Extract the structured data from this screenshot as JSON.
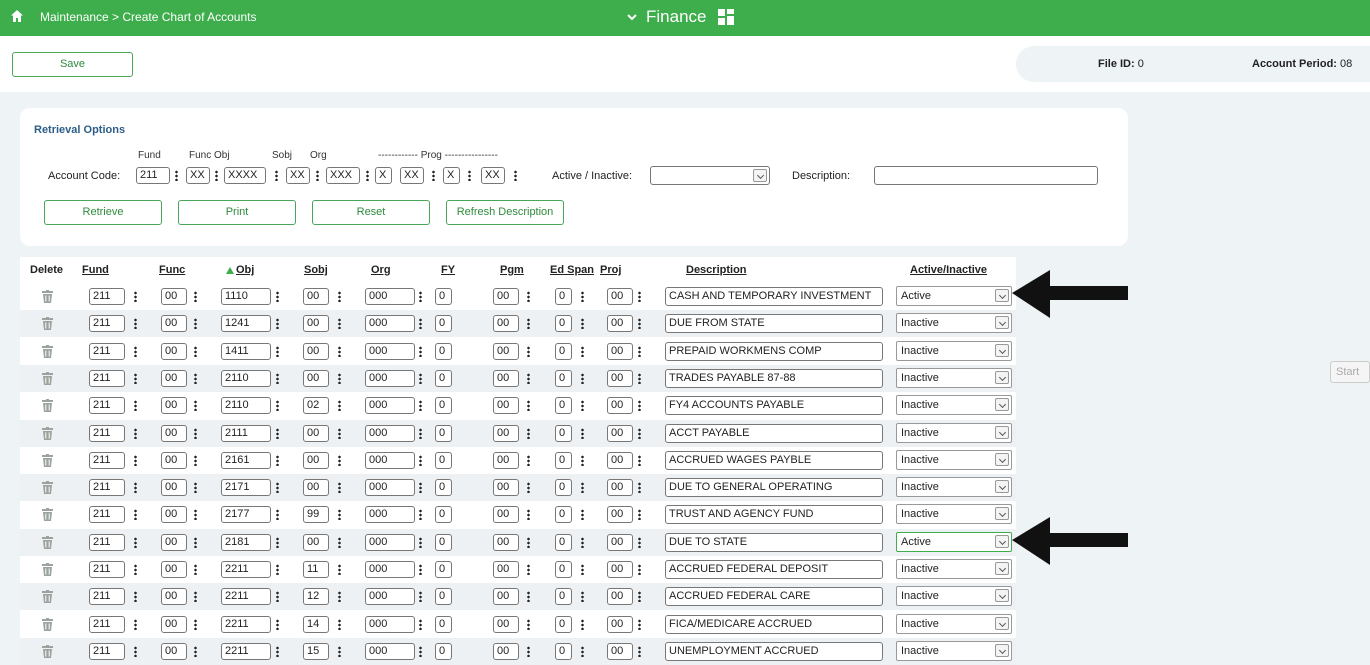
{
  "topbar": {
    "breadcrumb": "Maintenance > Create Chart of Accounts",
    "module": "Finance"
  },
  "toolbar": {
    "save_label": "Save",
    "file_id_label": "File ID:",
    "file_id_value": "0",
    "account_period_label": "Account Period:",
    "account_period_value": "08"
  },
  "retrieval": {
    "title": "Retrieval Options",
    "headers": {
      "fund": "Fund",
      "func": "Func",
      "obj": "Obj",
      "sobj": "Sobj",
      "org": "Org",
      "prog": "------------ Prog ----------------"
    },
    "account_code_label": "Account Code:",
    "fund": "211",
    "func": "XX",
    "obj": "XXXX",
    "sobj": "XX",
    "org": "XXX",
    "fy": "X",
    "pgm": "XX",
    "ed": "X",
    "proj": "XX",
    "active_label": "Active / Inactive:",
    "active_value": "",
    "description_label": "Description:",
    "description_value": "",
    "buttons": {
      "retrieve": "Retrieve",
      "print": "Print",
      "reset": "Reset",
      "refresh": "Refresh Description"
    }
  },
  "grid": {
    "columns": {
      "delete": "Delete",
      "fund": "Fund",
      "func": "Func",
      "obj": "Obj",
      "sobj": "Sobj",
      "org": "Org",
      "fy": "FY",
      "pgm": "Pgm",
      "edspan": "Ed Span",
      "proj": "Proj",
      "description": "Description",
      "status": "Active/Inactive"
    },
    "rows": [
      {
        "fund": "211",
        "func": "00",
        "obj": "1110",
        "sobj": "00",
        "org": "000",
        "fy": "0",
        "pgm": "00",
        "ed": "0",
        "proj": "00",
        "desc": "CASH AND TEMPORARY INVESTMENT",
        "status": "Active"
      },
      {
        "fund": "211",
        "func": "00",
        "obj": "1241",
        "sobj": "00",
        "org": "000",
        "fy": "0",
        "pgm": "00",
        "ed": "0",
        "proj": "00",
        "desc": "DUE FROM STATE",
        "status": "Inactive"
      },
      {
        "fund": "211",
        "func": "00",
        "obj": "1411",
        "sobj": "00",
        "org": "000",
        "fy": "0",
        "pgm": "00",
        "ed": "0",
        "proj": "00",
        "desc": "PREPAID WORKMENS COMP",
        "status": "Inactive"
      },
      {
        "fund": "211",
        "func": "00",
        "obj": "2110",
        "sobj": "00",
        "org": "000",
        "fy": "0",
        "pgm": "00",
        "ed": "0",
        "proj": "00",
        "desc": "TRADES PAYABLE 87-88",
        "status": "Inactive"
      },
      {
        "fund": "211",
        "func": "00",
        "obj": "2110",
        "sobj": "02",
        "org": "000",
        "fy": "0",
        "pgm": "00",
        "ed": "0",
        "proj": "00",
        "desc": "FY4 ACCOUNTS PAYABLE",
        "status": "Inactive"
      },
      {
        "fund": "211",
        "func": "00",
        "obj": "2111",
        "sobj": "00",
        "org": "000",
        "fy": "0",
        "pgm": "00",
        "ed": "0",
        "proj": "00",
        "desc": "ACCT PAYABLE",
        "status": "Inactive"
      },
      {
        "fund": "211",
        "func": "00",
        "obj": "2161",
        "sobj": "00",
        "org": "000",
        "fy": "0",
        "pgm": "00",
        "ed": "0",
        "proj": "00",
        "desc": "ACCRUED WAGES PAYBLE",
        "status": "Inactive"
      },
      {
        "fund": "211",
        "func": "00",
        "obj": "2171",
        "sobj": "00",
        "org": "000",
        "fy": "0",
        "pgm": "00",
        "ed": "0",
        "proj": "00",
        "desc": "DUE TO GENERAL OPERATING",
        "status": "Inactive"
      },
      {
        "fund": "211",
        "func": "00",
        "obj": "2177",
        "sobj": "99",
        "org": "000",
        "fy": "0",
        "pgm": "00",
        "ed": "0",
        "proj": "00",
        "desc": "TRUST AND AGENCY FUND",
        "status": "Inactive"
      },
      {
        "fund": "211",
        "func": "00",
        "obj": "2181",
        "sobj": "00",
        "org": "000",
        "fy": "0",
        "pgm": "00",
        "ed": "0",
        "proj": "00",
        "desc": "DUE TO STATE",
        "status": "Active"
      },
      {
        "fund": "211",
        "func": "00",
        "obj": "2211",
        "sobj": "11",
        "org": "000",
        "fy": "0",
        "pgm": "00",
        "ed": "0",
        "proj": "00",
        "desc": "ACCRUED FEDERAL DEPOSIT",
        "status": "Inactive"
      },
      {
        "fund": "211",
        "func": "00",
        "obj": "2211",
        "sobj": "12",
        "org": "000",
        "fy": "0",
        "pgm": "00",
        "ed": "0",
        "proj": "00",
        "desc": "ACCRUED FEDERAL CARE",
        "status": "Inactive"
      },
      {
        "fund": "211",
        "func": "00",
        "obj": "2211",
        "sobj": "14",
        "org": "000",
        "fy": "0",
        "pgm": "00",
        "ed": "0",
        "proj": "00",
        "desc": "FICA/MEDICARE ACCRUED",
        "status": "Inactive"
      },
      {
        "fund": "211",
        "func": "00",
        "obj": "2211",
        "sobj": "15",
        "org": "000",
        "fy": "0",
        "pgm": "00",
        "ed": "0",
        "proj": "00",
        "desc": "UNEMPLOYMENT ACCRUED",
        "status": "Inactive"
      }
    ]
  },
  "side": {
    "start_label": "Start"
  },
  "colors": {
    "brand": "#3eae4c",
    "title_blue": "#2d5d86"
  },
  "icons": [
    "home-icon",
    "chevron-down-icon",
    "grid-icon",
    "trash-icon",
    "dropdown-arrow-icon",
    "pointer-arrow-icon"
  ]
}
